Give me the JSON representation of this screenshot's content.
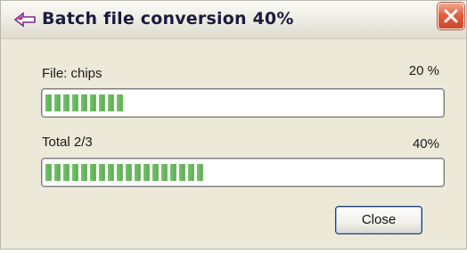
{
  "window": {
    "title": "Batch file conversion 40%",
    "title_icon": "arrow-icon",
    "close_icon": "close-icon"
  },
  "file_progress": {
    "label": "File: chips",
    "percent_text": "20 %",
    "fraction": 0.2
  },
  "total_progress": {
    "label": "Total 2/3",
    "percent_text": "40%",
    "fraction": 0.4
  },
  "buttons": {
    "close_label": "Close"
  },
  "colors": {
    "progress_green": "#6ab860",
    "title_text": "#1b1b3f",
    "close_red": "#d9532f",
    "dialog_bg": "#ece9d8"
  }
}
